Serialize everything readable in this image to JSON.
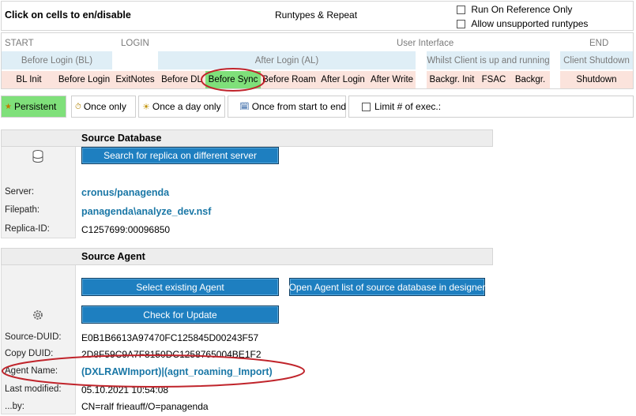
{
  "header": {
    "title": "Click on cells to en/disable",
    "runtypes": "Runtypes & Repeat",
    "run_on_reference": "Run On Reference Only",
    "allow_unsupported": "Allow unsupported runtypes"
  },
  "phases": {
    "start": "START",
    "login": "LOGIN",
    "user_interface": "User Interface",
    "end": "END"
  },
  "groups": {
    "before_login": "Before Login (BL)",
    "after_login": "After Login (AL)",
    "whilst_client": "Whilst Client is up and running",
    "client_shutdown": "Client Shutdown"
  },
  "runtypes": {
    "bl_init": "BL Init",
    "before_login": "Before Login",
    "exit_notes": "ExitNotes",
    "before_dl": "Before DL",
    "before_sync": "Before Sync",
    "before_roam": "Before Roam",
    "after_login": "After Login",
    "after_write": "After Write",
    "backgr_init": "Backgr. Init",
    "fsac": "FSAC",
    "backgr": "Backgr.",
    "shutdown": "Shutdown"
  },
  "modes": {
    "persistent": "Persistent",
    "once_only": "Once only",
    "once_a_day": "Once a day only",
    "once_start_end": "Once from start to end",
    "limit": "Limit # of exec.:"
  },
  "source_database": {
    "heading": "Source Database",
    "search_button": "Search for replica on different server",
    "server_label": "Server:",
    "server_value": "cronus/panagenda",
    "filepath_label": "Filepath:",
    "filepath_value": "panagenda\\analyze_dev.nsf",
    "replica_label": "Replica-ID:",
    "replica_value": "C1257699:00096850"
  },
  "source_agent": {
    "heading": "Source Agent",
    "select_button": "Select existing Agent",
    "open_list_button": "Open Agent list of source database in designer",
    "check_update_button": "Check for Update",
    "source_duid_label": "Source-DUID:",
    "source_duid_value": "E0B1B6613A97470FC125845D00243F57",
    "copy_duid_label": "Copy DUID:",
    "copy_duid_value": "2D8F59C9A7F8150DC1258765004BE1F2",
    "agent_name_label": "Agent Name:",
    "agent_name_value": "(DXLRAWImport)|(agnt_roaming_Import)",
    "last_modified_label": "Last modified:",
    "last_modified_value": "05.10.2021 10:54:08",
    "by_label": "...by:",
    "by_value": "CN=ralf frieauff/O=panagenda"
  },
  "colors": {
    "highlight_green": "#7fe07a",
    "annotation_red": "#c0242b",
    "button_blue": "#1e7fc0",
    "link_blue": "#1a77a6"
  }
}
